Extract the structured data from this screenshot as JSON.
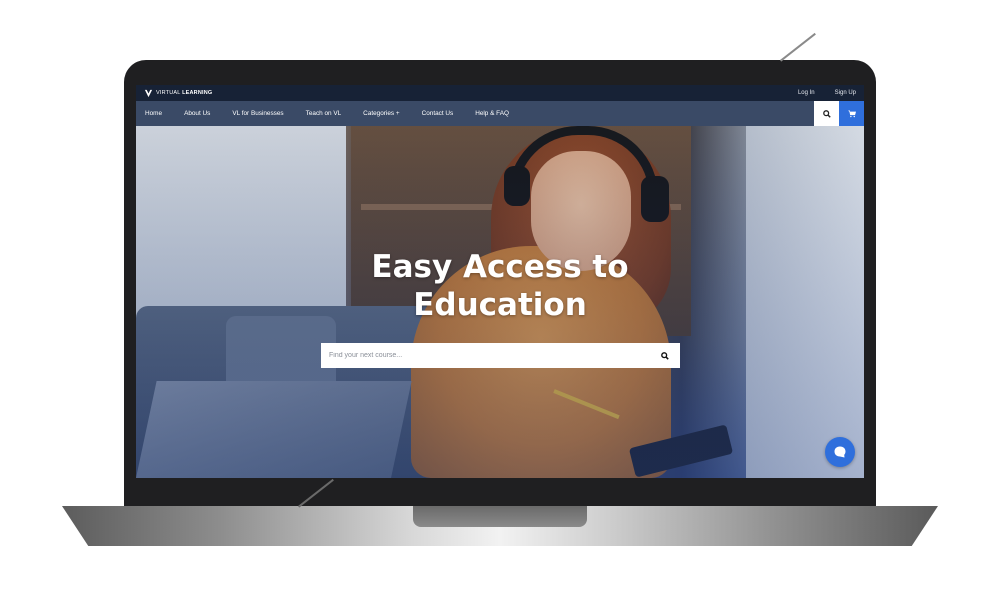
{
  "brand": {
    "logo_text_light": "VIRTUAL ",
    "logo_text_bold": "LEARNING"
  },
  "topbar": {
    "login_label": "Log In",
    "signup_label": "Sign Up"
  },
  "nav": {
    "items": [
      {
        "label": "Home"
      },
      {
        "label": "About Us"
      },
      {
        "label": "VL for Businesses"
      },
      {
        "label": "Teach on VL"
      },
      {
        "label": "Categories +"
      },
      {
        "label": "Contact Us"
      },
      {
        "label": "Help & FAQ"
      }
    ],
    "search_icon": "search-icon",
    "cart_icon": "cart-icon"
  },
  "hero": {
    "headline_line1": "Easy Access to",
    "headline_line2": "Education",
    "search_placeholder": "Find your next course...",
    "search_icon": "search-icon"
  },
  "chat": {
    "icon": "chat-icon"
  },
  "colors": {
    "topbar_bg": "#172236",
    "navbar_bg": "#3a4a66",
    "accent": "#2f6fdc",
    "laptop_lid": "#1f1f21"
  }
}
